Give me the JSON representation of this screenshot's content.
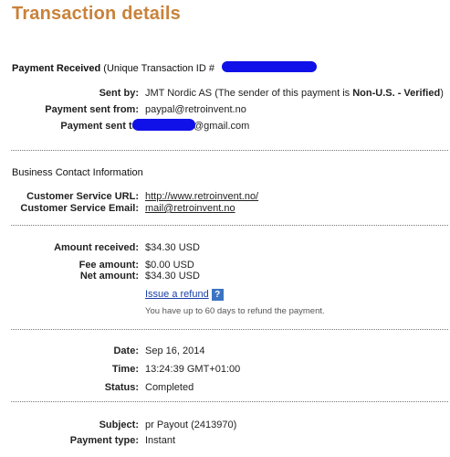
{
  "page": {
    "title": "Transaction details"
  },
  "payment": {
    "heading": "Payment Received",
    "id_prefix": "(Unique Transaction ID #",
    "sent_by_label": "Sent by:",
    "sent_by_value": "JMT Nordic AS (The sender of this payment is ",
    "sent_by_status": "Non-U.S. - Verified",
    "sent_by_close": ")",
    "sent_from_label": "Payment sent from:",
    "sent_from_value": "paypal@retroinvent.no",
    "sent_to_label": "Payment sent to:",
    "sent_to_value": "@gmail.com"
  },
  "business": {
    "heading": "Business Contact Information",
    "url_label": "Customer Service URL:",
    "url_value": "http://www.retroinvent.no/",
    "email_label": "Customer Service Email:",
    "email_value": "mail@retroinvent.no"
  },
  "amounts": {
    "received_label": "Amount received:",
    "received_value": "$34.30 USD",
    "fee_label": "Fee amount:",
    "fee_value": "$0.00 USD",
    "net_label": "Net amount:",
    "net_value": "$34.30 USD",
    "refund_link": "Issue a refund",
    "help_icon": "?",
    "refund_note": "You have up to 60 days to refund the payment."
  },
  "status": {
    "date_label": "Date:",
    "date_value": "Sep 16, 2014",
    "time_label": "Time:",
    "time_value": "13:24:39 GMT+01:00",
    "status_label": "Status:",
    "status_value": "Completed"
  },
  "details": {
    "subject_label": "Subject:",
    "subject_value": "pr Payout (2413970)",
    "type_label": "Payment type:",
    "type_value": "Instant"
  },
  "colors": {
    "title": "#c9823a",
    "link": "#1a3fa8",
    "redaction": "#1010e8",
    "help_icon": "#3b74c2"
  }
}
